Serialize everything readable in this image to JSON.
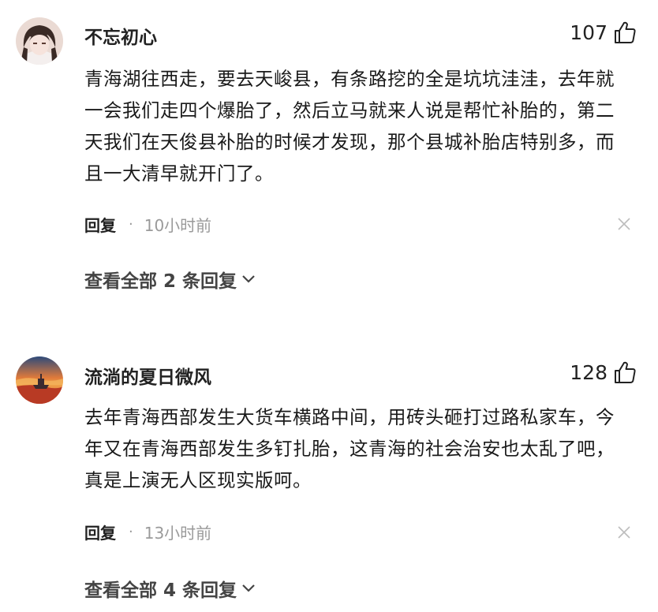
{
  "comments": [
    {
      "username": "不忘初心",
      "likes": "107",
      "text": "青海湖往西走，要去天峻县，有条路挖的全是坑坑洼洼，去年就一会我们走四个爆胎了，然后立马就来人说是帮忙补胎的，第二天我们在天俊县补胎的时候才发现，那个县城补胎店特别多，而且一大清早就开门了。",
      "reply_label": "回复",
      "dot": "·",
      "time": "10小时前",
      "view_replies": "查看全部 2 条回复",
      "avatar_icon": "anime-portrait-avatar",
      "colors": {
        "avatar_bg": "#e9d7cf"
      }
    },
    {
      "username": "流淌的夏日微风",
      "likes": "128",
      "text": "去年青海西部发生大货车横路中间，用砖头砸打过路私家车，今年又在青海西部发生多钉扎胎，这青海的社会治安也太乱了吧，真是上演无人区现实版呵。",
      "reply_label": "回复",
      "dot": "·",
      "time": "13小时前",
      "view_replies": "查看全部 4 条回复",
      "avatar_icon": "sunset-boat-avatar",
      "colors": {
        "avatar_bg": "#d7572b"
      }
    }
  ]
}
